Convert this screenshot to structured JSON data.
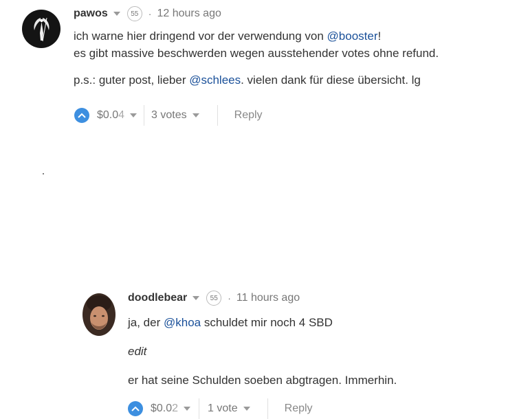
{
  "comments": [
    {
      "author": "pawos",
      "reputation": "55",
      "time": "12 hours ago",
      "line1_before": "ich warne hier dringend vor der verwendung von ",
      "line1_mention": "@booster",
      "line1_after": "!",
      "line2": "es gibt massive beschwerden wegen ausstehender votes ohne refund.",
      "line3_before": "p.s.: guter post, lieber ",
      "line3_mention": "@schlees",
      "line3_after": ". vielen dank für diese übersicht. lg",
      "payout_main": "$0.0",
      "payout_dim": "4",
      "votes": "3 votes",
      "reply": "Reply"
    },
    {
      "author": "doodlebear",
      "reputation": "55",
      "time": "11 hours ago",
      "line1_before": "ja, der ",
      "line1_mention": "@khoa",
      "line1_after": " schuldet mir noch 4 SBD",
      "line2": "edit",
      "line3": "er hat seine Schulden soeben abgtragen. Immerhin.",
      "payout_main": "$0.0",
      "payout_dim": "2",
      "votes": "1 vote",
      "reply": "Reply"
    }
  ],
  "colors": {
    "accent": "#3d8fe0",
    "mention": "#1a5099",
    "text": "#333333",
    "muted": "#777777"
  },
  "icons": [
    "upvote-icon",
    "dropdown-caret-icon"
  ]
}
